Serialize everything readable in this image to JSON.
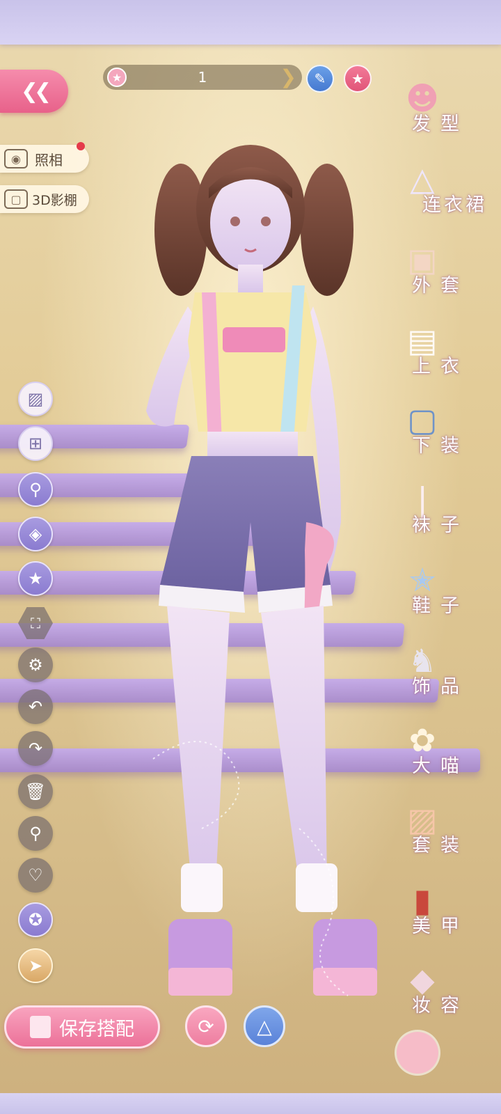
{
  "topbar": {
    "back_icon": "double-chevron-left",
    "page_number": "1",
    "next_icon": "chevron-right",
    "edit_icon": "pencil",
    "favorite_icon": "star"
  },
  "left_panel": {
    "photo_label": "照相",
    "studio_label": "3D影棚",
    "tools": [
      {
        "icon": "filter-icon"
      },
      {
        "icon": "add-layer-icon"
      },
      {
        "icon": "search-swap-icon"
      },
      {
        "icon": "palette-icon"
      },
      {
        "icon": "star-edit-icon"
      },
      {
        "icon": "fullscreen-icon"
      },
      {
        "icon": "gear-icon"
      },
      {
        "icon": "undo-icon"
      },
      {
        "icon": "redo-icon"
      },
      {
        "icon": "trash-icon"
      },
      {
        "icon": "search-icon"
      },
      {
        "icon": "heart-icon"
      },
      {
        "icon": "star-badge-icon"
      },
      {
        "icon": "megaphone-icon"
      }
    ]
  },
  "categories": [
    {
      "label": "发型"
    },
    {
      "label": "连衣裙"
    },
    {
      "label": "外套"
    },
    {
      "label": "上衣"
    },
    {
      "label": "下装"
    },
    {
      "label": "袜子"
    },
    {
      "label": "鞋子"
    },
    {
      "label": "饰品"
    },
    {
      "label": "大喵"
    },
    {
      "label": "套装"
    },
    {
      "label": "美甲"
    },
    {
      "label": "妆容"
    }
  ],
  "bottom": {
    "save_label": "保存搭配"
  },
  "colors": {
    "accent_pink": "#ec7199",
    "frame_lavender": "#c9c3ea",
    "tool_purple": "#8a7bd0"
  }
}
